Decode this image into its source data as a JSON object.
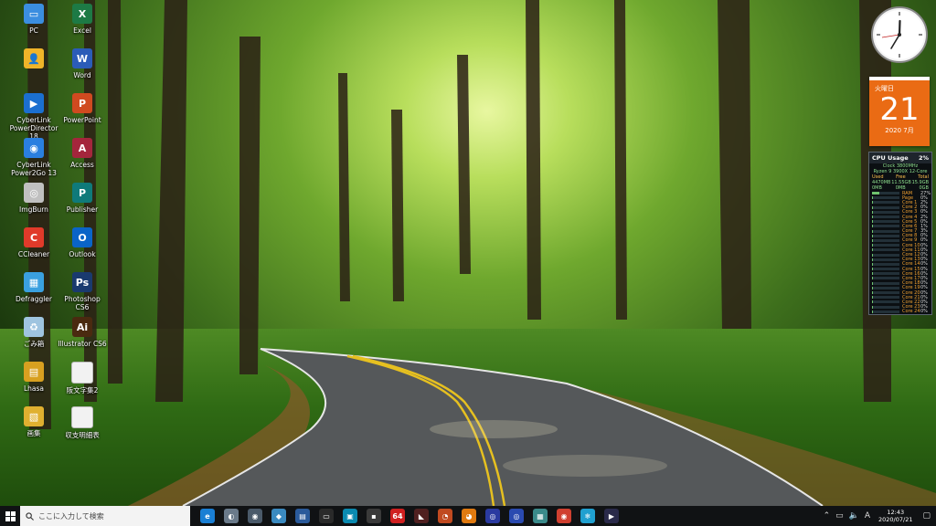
{
  "desktop": {
    "icons": [
      {
        "label": "PC",
        "icon": "pc-icon",
        "color": "#3b8ee0"
      },
      {
        "label": "",
        "icon": "user-folder-icon",
        "color": "#f0b429"
      },
      {
        "label": "CyberLink\nPowerDirector 18",
        "icon": "powerdirector-icon",
        "color": "#1b6fd0"
      },
      {
        "label": "CyberLink\nPower2Go 13",
        "icon": "power2go-icon",
        "color": "#2a7fe0"
      },
      {
        "label": "ImgBurn",
        "icon": "imgburn-icon",
        "color": "#c0c0c0"
      },
      {
        "label": "CCleaner",
        "icon": "ccleaner-icon",
        "color": "#e03a2a"
      },
      {
        "label": "Defraggler",
        "icon": "defraggler-icon",
        "color": "#3aa0e0"
      },
      {
        "label": "ごみ箱",
        "icon": "recycle-bin-icon",
        "color": "#9fc4e0"
      },
      {
        "label": "Lhasa",
        "icon": "lhasa-icon",
        "color": "#d8a020"
      },
      {
        "label": "画集",
        "icon": "gallery-folder-icon",
        "color": "#e0b030"
      },
      {
        "label": "Excel",
        "icon": "excel-icon",
        "color": "#1d7a45"
      },
      {
        "label": "Word",
        "icon": "word-icon",
        "color": "#2b5cb8"
      },
      {
        "label": "PowerPoint",
        "icon": "powerpoint-icon",
        "color": "#d04a20"
      },
      {
        "label": "Access",
        "icon": "access-icon",
        "color": "#a4263c"
      },
      {
        "label": "Publisher",
        "icon": "publisher-icon",
        "color": "#0f7a7a"
      },
      {
        "label": "Outlook",
        "icon": "outlook-icon",
        "color": "#0a64c8"
      },
      {
        "label": "Photoshop CS6",
        "icon": "photoshop-icon",
        "color": "#1a3a6e"
      },
      {
        "label": "Illustrator CS6",
        "icon": "illustrator-icon",
        "color": "#4a2a10"
      },
      {
        "label": "阪文字集2",
        "icon": "document-icon",
        "color": "#f2f2f2"
      },
      {
        "label": "収支明細表",
        "icon": "document-icon",
        "color": "#f2f2f2"
      }
    ],
    "glyphs": [
      "▭",
      "👤",
      "▶",
      "◉",
      "◎",
      "C",
      "▦",
      "♻",
      "▤",
      "▧",
      "X",
      "W",
      "P",
      "A",
      "P",
      "O",
      "Ps",
      "Ai",
      "",
      ""
    ]
  },
  "calendar": {
    "weekday": "火曜日",
    "day": "21",
    "year_month": "2020 7月",
    "color": "#ea6b14"
  },
  "cpu_gadget": {
    "title": "CPU Usage",
    "total_percent": "2%",
    "clock": "Clock 3800MHz",
    "model": "Ryzen 9 3900X 12-Core",
    "mem_headers": [
      "Used",
      "Free",
      "Total"
    ],
    "mem_values": [
      "4470MB",
      "11.55GB",
      "15.9GB"
    ],
    "swap_values": [
      "0MB",
      "0MB",
      "0GB"
    ],
    "rows": [
      {
        "name": "RAM",
        "percent": "27%",
        "level": 0.27
      },
      {
        "name": "Page",
        "percent": "0%",
        "level": 0.0
      },
      {
        "name": "Core 1",
        "percent": "2%",
        "level": 0.02
      },
      {
        "name": "Core 2",
        "percent": "0%",
        "level": 0.0
      },
      {
        "name": "Core 3",
        "percent": "0%",
        "level": 0.0
      },
      {
        "name": "Core 4",
        "percent": "2%",
        "level": 0.02
      },
      {
        "name": "Core 5",
        "percent": "0%",
        "level": 0.0
      },
      {
        "name": "Core 6",
        "percent": "1%",
        "level": 0.01
      },
      {
        "name": "Core 7",
        "percent": "3%",
        "level": 0.03
      },
      {
        "name": "Core 8",
        "percent": "0%",
        "level": 0.0
      },
      {
        "name": "Core 9",
        "percent": "0%",
        "level": 0.0
      },
      {
        "name": "Core 10",
        "percent": "0%",
        "level": 0.0
      },
      {
        "name": "Core 11",
        "percent": "0%",
        "level": 0.0
      },
      {
        "name": "Core 12",
        "percent": "0%",
        "level": 0.0
      },
      {
        "name": "Core 13",
        "percent": "0%",
        "level": 0.0
      },
      {
        "name": "Core 14",
        "percent": "0%",
        "level": 0.0
      },
      {
        "name": "Core 15",
        "percent": "0%",
        "level": 0.0
      },
      {
        "name": "Core 16",
        "percent": "0%",
        "level": 0.0
      },
      {
        "name": "Core 17",
        "percent": "0%",
        "level": 0.0
      },
      {
        "name": "Core 18",
        "percent": "0%",
        "level": 0.0
      },
      {
        "name": "Core 19",
        "percent": "0%",
        "level": 0.0
      },
      {
        "name": "Core 20",
        "percent": "0%",
        "level": 0.0
      },
      {
        "name": "Core 21",
        "percent": "0%",
        "level": 0.0
      },
      {
        "name": "Core 22",
        "percent": "0%",
        "level": 0.0
      },
      {
        "name": "Core 23",
        "percent": "0%",
        "level": 0.0
      },
      {
        "name": "Core 24",
        "percent": "0%",
        "level": 0.0
      }
    ]
  },
  "taskbar": {
    "search_placeholder": "ここに入力して検索",
    "apps": [
      {
        "icon": "edge-icon",
        "glyph": "e",
        "color": "#1a7fd4"
      },
      {
        "icon": "app-icon-2",
        "glyph": "◐",
        "color": "#6a7a8a"
      },
      {
        "icon": "app-icon-3",
        "glyph": "◉",
        "color": "#4a5a6a"
      },
      {
        "icon": "app-icon-4",
        "glyph": "◆",
        "color": "#3a8ac0"
      },
      {
        "icon": "app-icon-5",
        "glyph": "▤",
        "color": "#2a5a9a"
      },
      {
        "icon": "terminal-icon",
        "glyph": "▭",
        "color": "#2a2a2a"
      },
      {
        "icon": "app-icon-7",
        "glyph": "▣",
        "color": "#0a8ab0"
      },
      {
        "icon": "app-icon-8",
        "glyph": "▪",
        "color": "#3a3a3a"
      },
      {
        "icon": "app-64-icon",
        "glyph": "64",
        "color": "#d02020"
      },
      {
        "icon": "app-icon-10",
        "glyph": "◣",
        "color": "#502020"
      },
      {
        "icon": "app-icon-11",
        "glyph": "◔",
        "color": "#c04a20"
      },
      {
        "icon": "blender-icon",
        "glyph": "◕",
        "color": "#e07a10"
      },
      {
        "icon": "app-icon-13",
        "glyph": "◎",
        "color": "#2a3aa0"
      },
      {
        "icon": "app-icon-14",
        "glyph": "◎",
        "color": "#2a4ab0"
      },
      {
        "icon": "app-icon-15",
        "glyph": "▦",
        "color": "#3a8a8a"
      },
      {
        "icon": "chrome-icon",
        "glyph": "◉",
        "color": "#d04030"
      },
      {
        "icon": "app-icon-17",
        "glyph": "❄",
        "color": "#20a0d0"
      },
      {
        "icon": "media-icon",
        "glyph": "▶",
        "color": "#2a2a4a"
      }
    ],
    "tray": {
      "ime": "A",
      "time": "12:43",
      "date": "2020/07/21"
    }
  }
}
